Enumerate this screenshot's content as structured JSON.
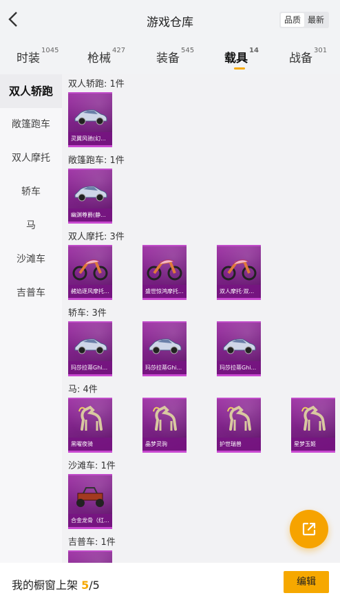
{
  "header": {
    "title": "游戏仓库",
    "sort_options": [
      "品质",
      "最新"
    ]
  },
  "tabs": [
    {
      "label": "时装",
      "count": "1045"
    },
    {
      "label": "枪械",
      "count": "427"
    },
    {
      "label": "装备",
      "count": "545"
    },
    {
      "label": "载具",
      "count": "14"
    },
    {
      "label": "战备",
      "count": "301"
    }
  ],
  "sidebar": {
    "items": [
      "双人轿跑",
      "敞篷跑车",
      "双人摩托",
      "轿车",
      "马",
      "沙滩车",
      "吉普车"
    ]
  },
  "sections": [
    {
      "title": "双人轿跑: 1件",
      "items": [
        {
          "label": "灵翼风驰(幻...",
          "icon": "car-icon"
        }
      ]
    },
    {
      "title": "敞篷跑车: 1件",
      "items": [
        {
          "label": "幽渊尊爵(静...",
          "icon": "car-icon"
        }
      ]
    },
    {
      "title": "双人摩托: 3件",
      "items": [
        {
          "label": "赭焰逐风摩托...",
          "icon": "motorcycle-icon"
        },
        {
          "label": "盛世惊鸿摩托...",
          "icon": "motorcycle-icon"
        },
        {
          "label": "双人摩托·双...",
          "icon": "motorcycle-icon"
        }
      ]
    },
    {
      "title": "轿车: 3件",
      "items": [
        {
          "label": "玛莎拉蒂Ghi...",
          "icon": "car-icon"
        },
        {
          "label": "玛莎拉蒂Ghi...",
          "icon": "car-icon"
        },
        {
          "label": "玛莎拉蒂Ghi...",
          "icon": "car-icon"
        }
      ]
    },
    {
      "title": "马: 4件",
      "items": [
        {
          "label": "黑曜夜骑",
          "icon": "horse-icon"
        },
        {
          "label": "晶梦灵驹",
          "icon": "horse-icon"
        },
        {
          "label": "护世瑞兽",
          "icon": "horse-icon"
        },
        {
          "label": "星梦玉姬",
          "icon": "horse-icon"
        }
      ]
    },
    {
      "title": "沙滩车: 1件",
      "items": [
        {
          "label": "合金龙骨（红...",
          "icon": "buggy-icon"
        }
      ]
    },
    {
      "title": "吉普车: 1件",
      "items": [
        {
          "label": "",
          "icon": "jeep-icon"
        }
      ]
    }
  ],
  "bottom": {
    "text": "我的橱窗上架",
    "count_current": "5",
    "count_total": "/5",
    "edit_label": "编辑"
  },
  "colors": {
    "accent": "#f6a800",
    "card_bg": "#7d2287",
    "card_border": "#c848d0"
  }
}
